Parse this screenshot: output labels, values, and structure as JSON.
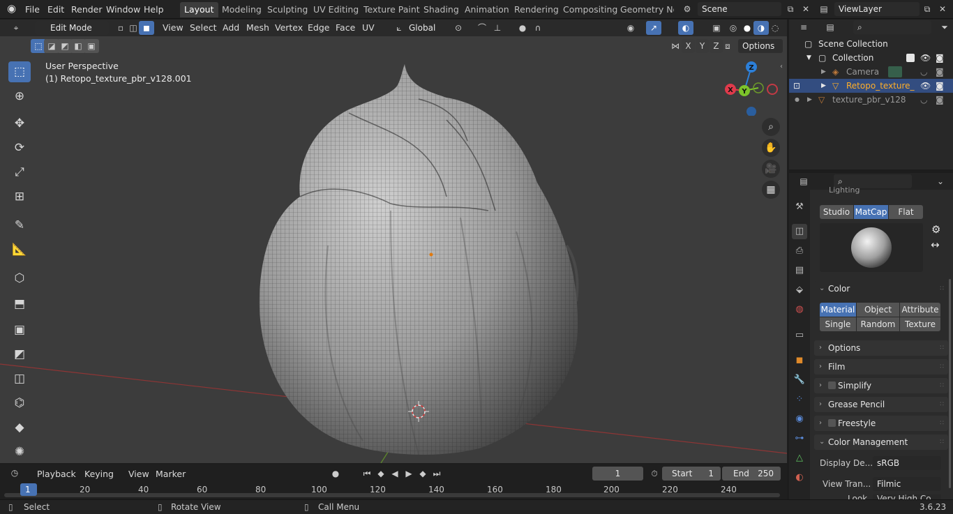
{
  "topbar": {
    "menus": [
      "File",
      "Edit",
      "Render",
      "Window",
      "Help"
    ],
    "workspaces": [
      "Layout",
      "Modeling",
      "Sculpting",
      "UV Editing",
      "Texture Paint",
      "Shading",
      "Animation",
      "Rendering",
      "Compositing",
      "Geometry Noc"
    ],
    "scene": "Scene",
    "view_layer": "ViewLayer"
  },
  "header": {
    "mode": "Edit Mode",
    "menus": [
      "View",
      "Select",
      "Add",
      "Mesh",
      "Vertex",
      "Edge",
      "Face",
      "UV"
    ],
    "transform": "Global",
    "axes": [
      "X",
      "Y",
      "Z"
    ],
    "options": "Options"
  },
  "viewport": {
    "perspective": "User Perspective",
    "object": "(1) Retopo_texture_pbr_v128.001",
    "gizmo": {
      "z": "Z",
      "y": "Y",
      "x": "X"
    }
  },
  "outliner": {
    "root": "Scene Collection",
    "collection": "Collection",
    "items": [
      "Camera",
      "Retopo_texture_",
      "texture_pbr_v128"
    ]
  },
  "properties": {
    "lighting_label": "Lighting",
    "lighting_modes": [
      "Studio",
      "MatCap",
      "Flat"
    ],
    "color_label": "Color",
    "color_modes": [
      "Material",
      "Object",
      "Attribute",
      "Single",
      "Random",
      "Texture"
    ],
    "panels": [
      "Options",
      "Film",
      "Simplify",
      "Grease Pencil",
      "Freestyle",
      "Color Management"
    ],
    "display_label": "Display De...",
    "display_value": "sRGB",
    "view_label": "View Tran...",
    "view_value": "Filmic",
    "look_label": "Look",
    "look_value": "Very High Co..."
  },
  "timeline": {
    "menus": [
      "Playback",
      "Keying",
      "View",
      "Marker"
    ],
    "current": "1",
    "start_label": "Start",
    "start": "1",
    "end_label": "End",
    "end": "250",
    "ticks": [
      "1",
      "20",
      "40",
      "60",
      "80",
      "100",
      "120",
      "140",
      "160",
      "180",
      "200",
      "220",
      "240"
    ]
  },
  "status": {
    "select": "Select",
    "rotate": "Rotate View",
    "call": "Call Menu",
    "version": "3.6.23"
  },
  "colors": {
    "accent": "#4772b3",
    "selected_text": "#ffaf29",
    "axis_x": "#e03a4b",
    "axis_y": "#7cc32a",
    "axis_z": "#2c7fd8"
  }
}
